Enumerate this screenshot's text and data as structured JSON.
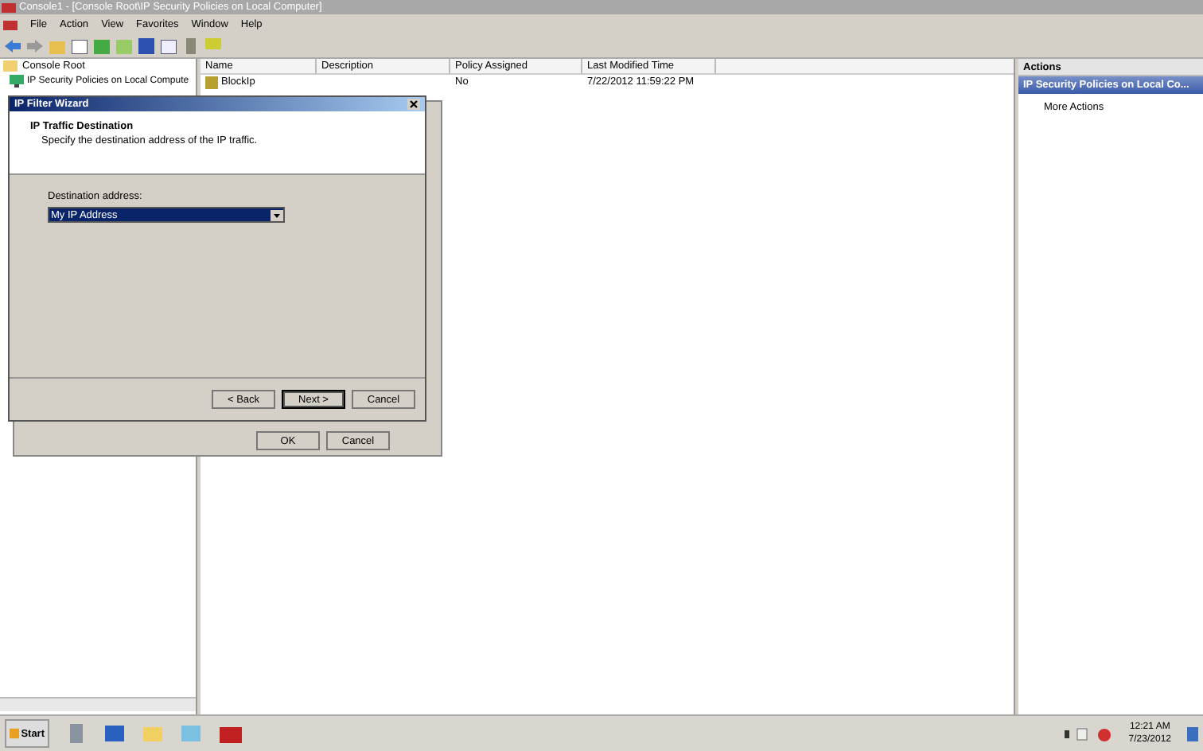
{
  "window": {
    "title": "Console1 - [Console Root\\IP Security Policies on Local Computer]"
  },
  "menu": [
    "File",
    "Action",
    "View",
    "Favorites",
    "Window",
    "Help"
  ],
  "tree": {
    "label": "Console Root",
    "children": [
      {
        "label": "IP Security Policies on Local Compute",
        "selected": false
      }
    ]
  },
  "table": {
    "columns": [
      "Name",
      "Description",
      "Policy Assigned",
      "Last Modified Time"
    ],
    "rows": [
      {
        "name": "BlockIp",
        "policy_assigned": "No",
        "last_modified": "7/22/2012 11:59:22 PM"
      }
    ]
  },
  "actions": {
    "title": "Actions",
    "section": "IP Security Policies on Local Co...",
    "items": [
      "More Actions"
    ]
  },
  "back_dialog": {
    "buttons": [
      "OK",
      "Cancel"
    ]
  },
  "wizard": {
    "title": "IP Filter Wizard",
    "heading": "IP Traffic Destination",
    "subheading": "Specify the destination address of the IP traffic.",
    "field_label": "Destination address:",
    "field_value": "My IP Address",
    "buttons": [
      {
        "label": "< Back",
        "default": false
      },
      {
        "label": "Next >",
        "default": true
      },
      {
        "label": "Cancel",
        "default": false
      }
    ]
  },
  "taskbar": {
    "start": "Start",
    "time": "12:21 AM",
    "date": "7/23/2012"
  }
}
